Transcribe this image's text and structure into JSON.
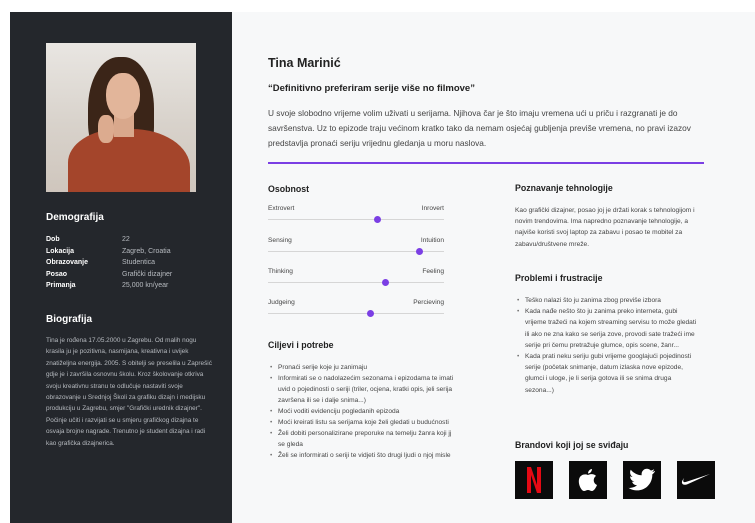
{
  "profile": {
    "name": "Tina Marinić",
    "quote": "“Definitivno preferiram serije više no filmove”",
    "intro": "U svoje slobodno vrijeme volim uživati u serijama. Njihova čar je što imaju vremena ući u priču i razgranati je do savršenstva. Uz to epizode traju većinom kratko tako da nemam osjećaj gubljenja previše vremena, no pravi izazov predstavlja pronaći seriju vrijednu gledanja u moru naslova."
  },
  "sidebar": {
    "demographics_title": "Demografija",
    "demographics": [
      {
        "key": "Dob",
        "value": "22"
      },
      {
        "key": "Lokacija",
        "value": "Zagreb, Croatia"
      },
      {
        "key": "Obrazovanje",
        "value": "Studentica"
      },
      {
        "key": "Posao",
        "value": "Grafički dizajner"
      },
      {
        "key": "Primanja",
        "value": "25,000 kn/year"
      }
    ],
    "bio_title": "Biografija",
    "bio": "Tina je rođena 17.05.2000 u Zagrebu. Od malih nogu krasila ju je pozitivna, nasmijana, kreativna i uvijek znatiželjna energija. 2005. S obitelji se preselila u Zaprešić gdje je i završila osnovnu školu. Kroz školovanje otkriva svoju kreativnu stranu te odlučuje nastaviti svoje obrazovanje u Srednjoj Školi za grafiku dizajn i medijsku produkciju u Zagrebu, smjer \"Grafički urednik dizajner\". Počinje učiti i razvijati se u smjeru grafičkog dizajna te osvaja brojne nagrade. Trenutno je student dizajna i radi kao grafička dizajnerica."
  },
  "personality": {
    "title": "Osobnost",
    "sliders": [
      {
        "left": "Extrovert",
        "right": "Inrovert",
        "value": 0.62
      },
      {
        "left": "Sensing",
        "right": "Intuition",
        "value": 0.86
      },
      {
        "left": "Thinking",
        "right": "Feeling",
        "value": 0.67
      },
      {
        "left": "Judgeing",
        "right": "Percieving",
        "value": 0.58
      }
    ]
  },
  "goals": {
    "title": "Ciljevi i potrebe",
    "items": [
      "Pronaći serije koje ju zanimaju",
      "Informirati se o nadolazećim sezonama i epizodama te imati uvid o pojedinosti o seriji (triler, ocjena, kratki opis, jeli serija završena ili se i dalje snima...)",
      "Moći voditi evidenciju pogledanih epizoda",
      "Moći kreirati listu sa serijama koje želi gledati u budućnosti",
      "Želi dobiti personalizirane preporuke na temelju žanra koji jj se gleda",
      "Želi se informirati o seriji te vidjeti što drugi ljudi o njoj misle"
    ]
  },
  "tech": {
    "title": "Poznavanje tehnologije",
    "text": "Kao grafički dizajner, posao joj je držati korak s tehnologijom i novim trendovima. Ima napredno poznavanje tehnologije, a najviše koristi svoj laptop za zabavu i posao te mobitel za zabavu/društvene mreže."
  },
  "problems": {
    "title": "Problemi i frustracije",
    "items": [
      "Teško nalazi što ju zanima zbog previše izbora",
      "Kada nađe nešto što ju zanima preko interneta, gubi vrijeme tražeći na kojem streaming servisu to može gledati ili ako ne zna kako se serija zove, provodi sate tražeći ime serije pri čemu pretražuje glumce, opis scene, žanr...",
      "Kada prati neku seriju gubi vrijeme googlajući pojedinosti serije (početak snimanje, datum izlaska nove epizode, glumci i uloge, je li serija gotova ili se snima druga sezona...)"
    ]
  },
  "brands": {
    "title": "Brandovi koji joj se sviđaju",
    "items": [
      {
        "icon": "netflix-logo-icon",
        "color": "#e50914"
      },
      {
        "icon": "apple-logo-icon",
        "color": "#ffffff"
      },
      {
        "icon": "twitter-logo-icon",
        "color": "#ffffff"
      },
      {
        "icon": "nike-logo-icon",
        "color": "#ffffff"
      }
    ]
  },
  "colors": {
    "accent": "#7b3fe4",
    "sidebar": "#24272c",
    "netflix": "#e50914"
  }
}
